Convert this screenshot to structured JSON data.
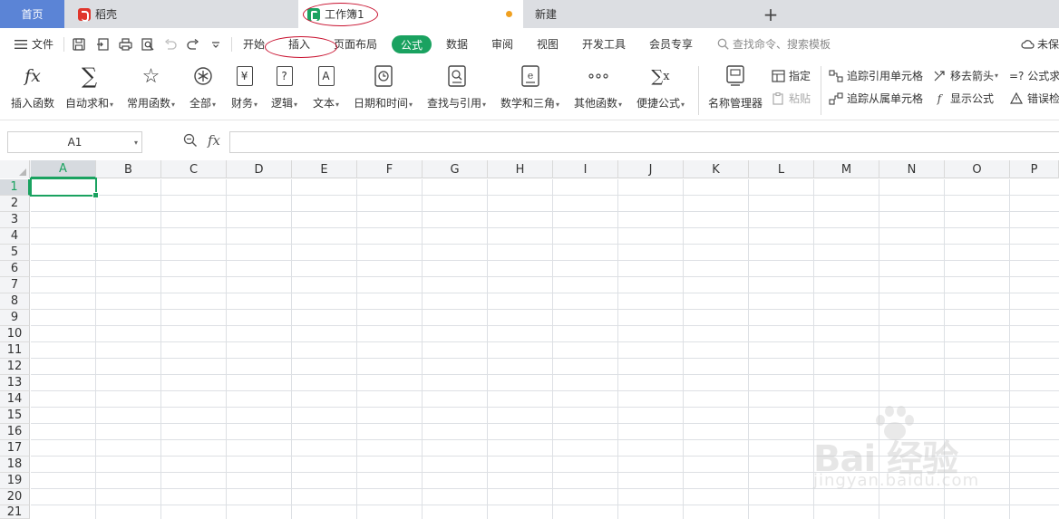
{
  "tabs": {
    "home": "首页",
    "daoke": "稻壳",
    "doc": "工作簿1",
    "new": "新建",
    "plus": "+"
  },
  "menu": {
    "file": "文件",
    "items": [
      "开始",
      "插入",
      "页面布局",
      "公式",
      "数据",
      "审阅",
      "视图",
      "开发工具",
      "会员专享"
    ],
    "active": "公式",
    "search_placeholder": "查找命令、搜索模板",
    "unsaved": "未保"
  },
  "ribbon": {
    "buttons": [
      {
        "icon": "fx-icon",
        "glyph": "fx",
        "label": "插入函数",
        "dropdown": false
      },
      {
        "icon": "sigma-icon",
        "glyph": "∑",
        "label": "自动求和",
        "dropdown": true
      },
      {
        "icon": "star-icon",
        "glyph": "☆",
        "label": "常用函数",
        "dropdown": true
      },
      {
        "icon": "all-functions-icon",
        "glyph": "⊛",
        "label": "全部",
        "dropdown": true
      },
      {
        "icon": "finance-icon",
        "glyph": "¥",
        "label": "财务",
        "dropdown": true
      },
      {
        "icon": "logic-icon",
        "glyph": "?",
        "label": "逻辑",
        "dropdown": true
      },
      {
        "icon": "text-icon",
        "glyph": "A",
        "label": "文本",
        "dropdown": true
      },
      {
        "icon": "datetime-icon",
        "glyph": "◷",
        "label": "日期和时间",
        "dropdown": true
      },
      {
        "icon": "lookup-icon",
        "glyph": "⌕",
        "label": "查找与引用",
        "dropdown": true
      },
      {
        "icon": "math-icon",
        "glyph": "θ",
        "label": "数学和三角",
        "dropdown": true
      },
      {
        "icon": "more-functions-icon",
        "glyph": "∘∘∘",
        "label": "其他函数",
        "dropdown": true
      },
      {
        "icon": "quick-formula-icon",
        "glyph": "∑x",
        "label": "便捷公式",
        "dropdown": true
      },
      {
        "icon": "name-manager-icon",
        "glyph": "▤",
        "label": "名称管理器",
        "dropdown": false
      }
    ],
    "define": "指定",
    "paste": "粘贴",
    "trace_precedents": "追踪引用单元格",
    "trace_dependents": "追踪从属单元格",
    "remove_arrows": "移去箭头",
    "show_formulas": "显示公式",
    "formula_eval": "=? 公式求",
    "error_check": "错误检"
  },
  "formula_bar": {
    "name_box": "A1",
    "fx": "fx",
    "value": ""
  },
  "sheet": {
    "columns": [
      "A",
      "B",
      "C",
      "D",
      "E",
      "F",
      "G",
      "H",
      "I",
      "J",
      "K",
      "L",
      "M",
      "N",
      "O",
      "P"
    ],
    "rows": [
      "1",
      "2",
      "3",
      "4",
      "5",
      "6",
      "7",
      "8",
      "9",
      "10",
      "11",
      "12",
      "13",
      "14",
      "15",
      "16",
      "17",
      "18",
      "19",
      "20",
      "21"
    ],
    "selected_col": "A",
    "selected_row": "1"
  },
  "watermark": {
    "main": "Bai 经验",
    "sub": "jingyan.baidu.com"
  },
  "colors": {
    "accent": "#1aa260",
    "home_tab": "#5b84d6",
    "annotation": "#c8102e"
  }
}
